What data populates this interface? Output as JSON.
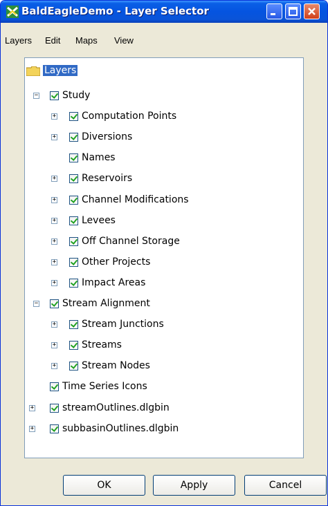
{
  "window": {
    "title": "BaldEagleDemo - Layer Selector"
  },
  "menu": [
    "Layers",
    "Edit",
    "Maps",
    "View"
  ],
  "tree": {
    "root": "Layers",
    "nodes": [
      {
        "label": "Study",
        "level": 1,
        "expander": "minus",
        "checked": true
      },
      {
        "label": "Computation Points",
        "level": 2,
        "expander": "plus",
        "checked": true
      },
      {
        "label": "Diversions",
        "level": 2,
        "expander": "plus",
        "checked": true
      },
      {
        "label": "Names",
        "level": 2,
        "expander": "none",
        "checked": true
      },
      {
        "label": "Reservoirs",
        "level": 2,
        "expander": "plus",
        "checked": true
      },
      {
        "label": "Channel Modifications",
        "level": 2,
        "expander": "plus",
        "checked": true
      },
      {
        "label": "Levees",
        "level": 2,
        "expander": "plus",
        "checked": true
      },
      {
        "label": "Off Channel Storage",
        "level": 2,
        "expander": "plus",
        "checked": true
      },
      {
        "label": "Other Projects",
        "level": 2,
        "expander": "plus",
        "checked": true
      },
      {
        "label": "Impact Areas",
        "level": 2,
        "expander": "plus",
        "checked": true
      },
      {
        "label": "Stream Alignment",
        "level": 1,
        "expander": "minus",
        "checked": true
      },
      {
        "label": "Stream Junctions",
        "level": 2,
        "expander": "plus",
        "checked": true
      },
      {
        "label": "Streams",
        "level": 2,
        "expander": "plus",
        "checked": true
      },
      {
        "label": "Stream Nodes",
        "level": 2,
        "expander": "plus",
        "checked": true
      },
      {
        "label": "Time Series Icons",
        "level": 1,
        "expander": "none",
        "checked": true
      },
      {
        "label": "streamOutlines.dlgbin",
        "level": 0,
        "expander": "plus",
        "checked": true
      },
      {
        "label": "subbasinOutlines.dlgbin",
        "level": 0,
        "expander": "plus",
        "checked": true
      }
    ]
  },
  "buttons": {
    "ok": "OK",
    "apply": "Apply",
    "cancel": "Cancel"
  }
}
